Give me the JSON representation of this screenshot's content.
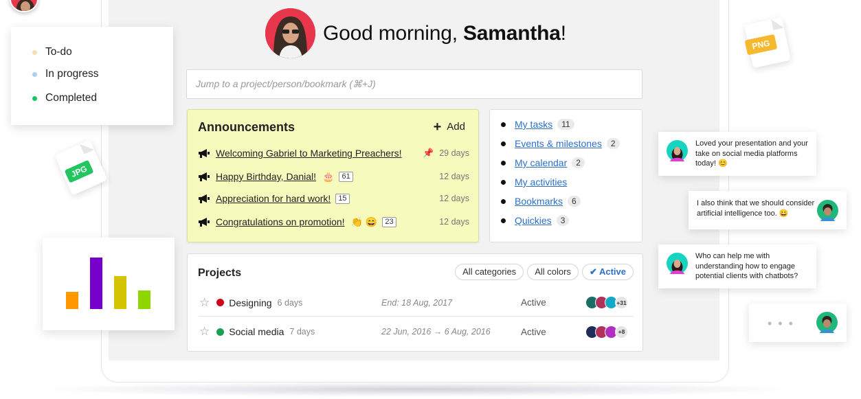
{
  "legend": {
    "items": [
      {
        "label": "To-do",
        "color": "#f7ddb0"
      },
      {
        "label": "In progress",
        "color": "#a9d3f3"
      },
      {
        "label": "Completed",
        "color": "#17c36b"
      }
    ]
  },
  "files": {
    "jpg_label": "JPG",
    "png_label": "PNG"
  },
  "mini_chart": {
    "chart_data": {
      "type": "bar",
      "categories": [
        "",
        "",
        "",
        ""
      ],
      "values": [
        25,
        75,
        48,
        27
      ],
      "colors": [
        "#ff9800",
        "#7600cc",
        "#d4c400",
        "#8fd600"
      ],
      "ylim": [
        0,
        80
      ]
    }
  },
  "greeting": {
    "prefix": "Good morning, ",
    "name": "Samantha",
    "suffix": "!"
  },
  "search": {
    "placeholder": "Jump to a project/person/bookmark (⌘+J)"
  },
  "announcements": {
    "title": "Announcements",
    "add_label": "Add",
    "items": [
      {
        "text": "Welcoming Gabriel to Marketing Preachers!",
        "emoji": "",
        "count": "",
        "days": "29 days",
        "pinned": true
      },
      {
        "text": "Happy Birthday, Danial!",
        "emoji": "🎂",
        "count": "61",
        "days": "12 days",
        "pinned": false
      },
      {
        "text": "Appreciation for hard work!",
        "emoji": "",
        "count": "15",
        "days": "12 days",
        "pinned": false
      },
      {
        "text": "Congratulations on promotion!",
        "emoji": "👏 😄",
        "count": "23",
        "days": "12 days",
        "pinned": false
      }
    ]
  },
  "quick_links": [
    {
      "label": "My tasks",
      "count": "11"
    },
    {
      "label": "Events & milestones",
      "count": "2"
    },
    {
      "label": "My calendar",
      "count": "2"
    },
    {
      "label": "My activities",
      "count": ""
    },
    {
      "label": "Bookmarks",
      "count": "6"
    },
    {
      "label": "Quickies",
      "count": "3"
    }
  ],
  "projects": {
    "title": "Projects",
    "filters": [
      {
        "label": "All categories",
        "active": false
      },
      {
        "label": "All colors",
        "active": false
      },
      {
        "label": "Active",
        "active": true
      }
    ],
    "rows": [
      {
        "name": "Designing",
        "duration": "6 days",
        "dates": "End: 18 Aug, 2017",
        "status": "Active",
        "color": "#d0021b",
        "more": "+31"
      },
      {
        "name": "Social media",
        "duration": "7 days",
        "dates": "22 Jun, 2016 → 6 Aug, 2016",
        "status": "Active",
        "color": "#1aa052",
        "more": "+8"
      }
    ]
  },
  "chats": [
    {
      "text": "Loved your presentation and your take on social media platforms today! 😊"
    },
    {
      "text": "I also think that we should consider artificial intelligence too. 😀"
    },
    {
      "text": "Who can help me with understanding how to engage potential clients with chatbots?"
    },
    {
      "text": "• • •"
    }
  ]
}
